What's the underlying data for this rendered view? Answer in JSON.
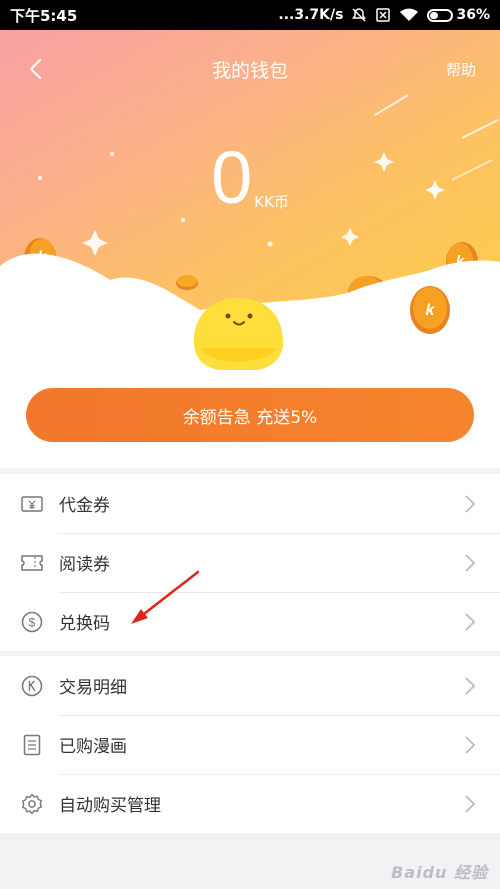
{
  "status_bar": {
    "time": "下午5:45",
    "network_speed": "...3.7K/s",
    "battery_percent": "36%",
    "battery_level": 0.36
  },
  "header": {
    "title": "我的钱包",
    "help_label": "帮助",
    "back_icon": "chevron-left-icon"
  },
  "balance": {
    "amount": "0",
    "unit": "KK币"
  },
  "promo": {
    "label": "余额告急 充送5%"
  },
  "list_1": [
    {
      "label": "代金券",
      "icon": "voucher-icon"
    },
    {
      "label": "阅读券",
      "icon": "ticket-icon"
    },
    {
      "label": "兑换码",
      "icon": "dollar-circle-icon"
    }
  ],
  "list_2": [
    {
      "label": "交易明细",
      "icon": "k-circle-icon"
    },
    {
      "label": "已购漫画",
      "icon": "document-icon"
    },
    {
      "label": "自动购买管理",
      "icon": "gear-icon"
    }
  ],
  "watermark": "Baidu 经验",
  "colors": {
    "promo_orange": "#f2772c",
    "gradient_start": "#f8a0a2",
    "gradient_end": "#fed045",
    "annotation_red": "#e0241b"
  }
}
